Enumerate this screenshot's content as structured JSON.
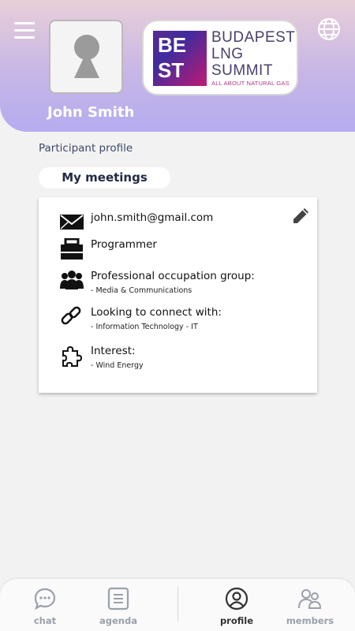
{
  "header": {
    "user_name": "John Smith",
    "logo": {
      "mark_line1": "BE",
      "mark_line2": "ST",
      "line1": "BUDAPEST",
      "line2": "LNG",
      "line3": "SUMMIT",
      "tagline": "ALL ABOUT NATURAL GAS"
    },
    "icons": {
      "menu": "hamburger-menu-icon",
      "language": "globe-icon",
      "avatar": "user-placeholder-icon"
    }
  },
  "profile": {
    "section_title": "Participant profile",
    "meetings_tab": "My meetings",
    "email": "john.smith@gmail.com",
    "job": "Programmer",
    "occupation_label": "Professional occupation group:",
    "occupation_value": "- Media & Communications",
    "connect_label": "Looking to connect with:",
    "connect_value": "- Information Technology - IT",
    "interest_label": "Interest:",
    "interest_value": "- Wind Energy"
  },
  "nav": {
    "items": [
      {
        "label": "chat",
        "icon": "chat-icon"
      },
      {
        "label": "agenda",
        "icon": "agenda-icon"
      },
      {
        "label": "profile",
        "icon": "profile-icon",
        "active": true
      },
      {
        "label": "members",
        "icon": "members-icon"
      }
    ]
  },
  "colors": {
    "header_gradient_top": "#e8cfd8",
    "header_gradient_bottom": "#b5acef",
    "background": "#f2f2f2",
    "card": "#ffffff"
  }
}
